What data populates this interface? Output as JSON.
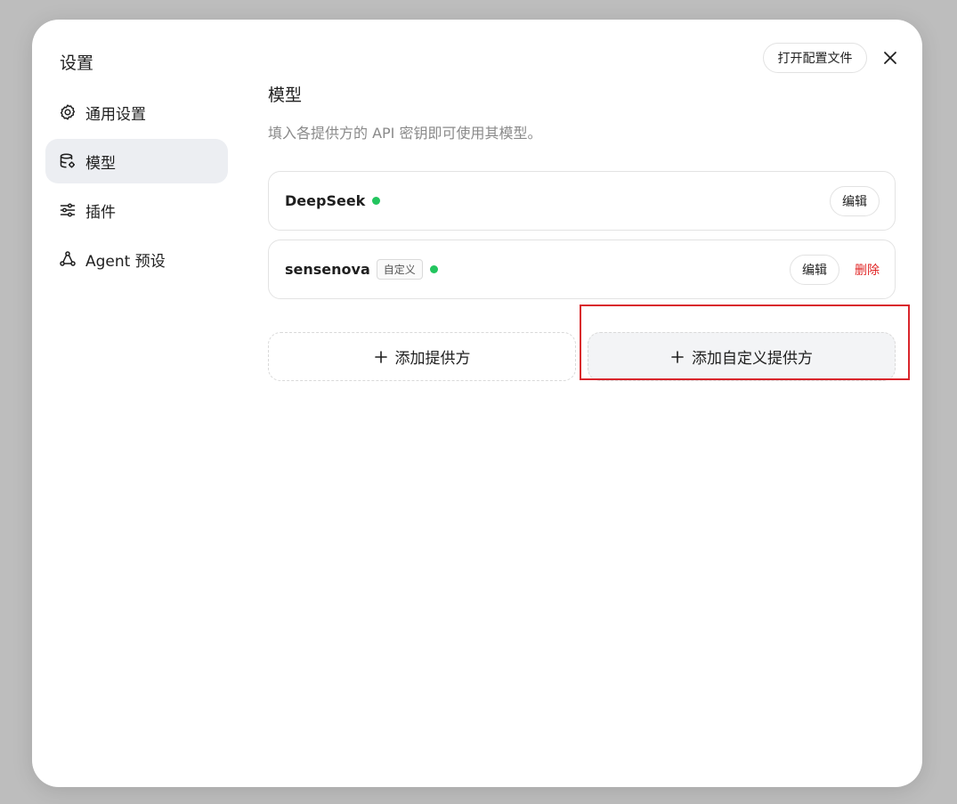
{
  "modal": {
    "title": "设置",
    "open_config_label": "打开配置文件"
  },
  "sidebar": {
    "items": [
      {
        "label": "通用设置",
        "icon": "gear-icon",
        "active": false
      },
      {
        "label": "模型",
        "icon": "database-gear-icon",
        "active": true
      },
      {
        "label": "插件",
        "icon": "sliders-icon",
        "active": false
      },
      {
        "label": "Agent 预设",
        "icon": "network-icon",
        "active": false
      }
    ]
  },
  "main": {
    "title": "模型",
    "description": "填入各提供方的 API 密钥即可使用其模型。",
    "providers": [
      {
        "name": "DeepSeek",
        "status": "active",
        "edit_label": "编辑"
      },
      {
        "name": "sensenova",
        "tag": "自定义",
        "status": "active",
        "edit_label": "编辑",
        "delete_label": "删除"
      }
    ],
    "add_provider_label": "添加提供方",
    "add_custom_provider_label": "添加自定义提供方"
  },
  "colors": {
    "status_active": "#22c55e",
    "delete": "#e02424",
    "active_nav_bg": "#eceef2",
    "highlight": "#d9262c"
  }
}
